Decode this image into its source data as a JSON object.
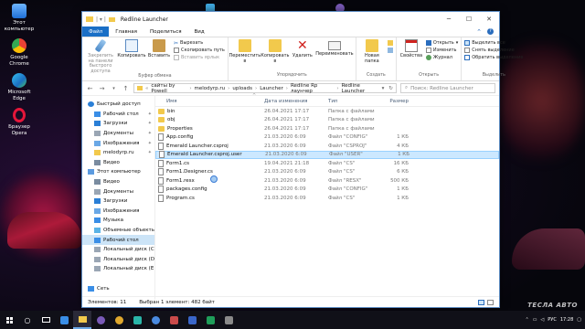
{
  "desktop": {
    "icons": [
      {
        "label": "Этот компьютер",
        "icon": "computer-icon"
      },
      {
        "label": "Google Chrome",
        "icon": "chrome-icon"
      },
      {
        "label": "Microsoft Edge",
        "icon": "edge-icon"
      },
      {
        "label": "Браузер Opera",
        "icon": "opera-icon"
      }
    ],
    "watermark": "ТЕСЛА АВТО"
  },
  "window": {
    "title": "Redline Launcher",
    "tabs": {
      "file": "Файл",
      "home": "Главная",
      "share": "Поделиться",
      "view": "Вид"
    },
    "ribbon": {
      "pin_quick": "Закрепить на панели быстрого доступа",
      "copy": "Копировать",
      "paste": "Вставить",
      "cut": "Вырезать",
      "copy_path": "Скопировать путь",
      "paste_shortcut": "Вставить ярлык",
      "clipboard_group": "Буфер обмена",
      "move_to": "Переместить в",
      "copy_to": "Копировать в",
      "delete": "Удалить",
      "rename": "Переименовать",
      "organize_group": "Упорядочить",
      "new_folder": "Новая папка",
      "new_group": "Создать",
      "properties": "Свойства",
      "open": "Открыть",
      "edit": "Изменить",
      "history": "Журнал",
      "open_group": "Открыть",
      "select_all": "Выделить все",
      "select_none": "Снять выделение",
      "invert_selection": "Обратить выделение",
      "select_group": "Выделить"
    },
    "address": {
      "crumbs": [
        "сайты by Powell",
        "melodyrp.ru",
        "uploads",
        "Launcher",
        "Redline Rp лаунчер",
        "Redline Launcher"
      ],
      "search_placeholder": "Поиск: Redline Launcher"
    },
    "nav": [
      {
        "label": "Быстрый доступ",
        "icon": "star-icon",
        "child": false,
        "pin": false
      },
      {
        "label": "Рабочий стол",
        "icon": "desktop-icon",
        "child": true,
        "pin": true
      },
      {
        "label": "Загрузки",
        "icon": "download-icon",
        "child": true,
        "pin": true
      },
      {
        "label": "Документы",
        "icon": "documents-icon",
        "child": true,
        "pin": true
      },
      {
        "label": "Изображения",
        "icon": "pictures-icon",
        "child": true,
        "pin": true
      },
      {
        "label": "melodyrp.ru",
        "icon": "folder-icon",
        "child": true,
        "pin": true
      },
      {
        "label": "Видео",
        "icon": "video-icon",
        "child": true,
        "pin": false
      },
      {
        "label": "Этот компьютер",
        "icon": "computer-icon",
        "child": false,
        "pin": false
      },
      {
        "label": "Видео",
        "icon": "video-icon",
        "child": true,
        "pin": false
      },
      {
        "label": "Документы",
        "icon": "documents-icon",
        "child": true,
        "pin": false
      },
      {
        "label": "Загрузки",
        "icon": "download-icon",
        "child": true,
        "pin": false
      },
      {
        "label": "Изображения",
        "icon": "pictures-icon",
        "child": true,
        "pin": false
      },
      {
        "label": "Музыка",
        "icon": "music-icon",
        "child": true,
        "pin": false
      },
      {
        "label": "Объемные объекты",
        "icon": "3d-objects-icon",
        "child": true,
        "pin": false
      },
      {
        "label": "Рабочий стол",
        "icon": "desktop-icon",
        "child": true,
        "pin": false,
        "selected": true
      },
      {
        "label": "Локальный диск (C",
        "icon": "drive-icon",
        "child": true,
        "pin": false
      },
      {
        "label": "Локальный диск (D",
        "icon": "drive-icon",
        "child": true,
        "pin": false
      },
      {
        "label": "Локальный диск (E",
        "icon": "drive-icon",
        "child": true,
        "pin": false
      },
      {
        "label": "",
        "icon": "",
        "child": false,
        "pin": false
      },
      {
        "label": "Сеть",
        "icon": "network-icon",
        "child": false,
        "pin": false
      }
    ],
    "columns": {
      "name": "Имя",
      "date": "Дата изменения",
      "type": "Тип",
      "size": "Размер"
    },
    "files": [
      {
        "name": "bin",
        "date": "26.04.2021 17:17",
        "type": "Папка с файлами",
        "size": "",
        "kind": "folder"
      },
      {
        "name": "obj",
        "date": "26.04.2021 17:17",
        "type": "Папка с файлами",
        "size": "",
        "kind": "folder"
      },
      {
        "name": "Properties",
        "date": "26.04.2021 17:17",
        "type": "Папка с файлами",
        "size": "",
        "kind": "folder"
      },
      {
        "name": "App.config",
        "date": "21.03.2020 6:09",
        "type": "Файл \"CONFIG\"",
        "size": "1 КБ",
        "kind": "file"
      },
      {
        "name": "Emerald Launcher.csproj",
        "date": "21.03.2020 6:09",
        "type": "Файл \"CSPROJ\"",
        "size": "4 КБ",
        "kind": "file"
      },
      {
        "name": "Emerald Launcher.csproj.user",
        "date": "21.03.2020 6:09",
        "type": "Файл \"USER\"",
        "size": "1 КБ",
        "kind": "file",
        "selected": true
      },
      {
        "name": "Form1.cs",
        "date": "19.04.2021 21:18",
        "type": "Файл \"CS\"",
        "size": "16 КБ",
        "kind": "file"
      },
      {
        "name": "Form1.Designer.cs",
        "date": "21.03.2020 6:09",
        "type": "Файл \"CS\"",
        "size": "6 КБ",
        "kind": "file"
      },
      {
        "name": "Form1.resx",
        "date": "21.03.2020 6:09",
        "type": "Файл \"RESX\"",
        "size": "500 КБ",
        "kind": "file"
      },
      {
        "name": "packages.config",
        "date": "21.03.2020 6:09",
        "type": "Файл \"CONFIG\"",
        "size": "1 КБ",
        "kind": "file"
      },
      {
        "name": "Program.cs",
        "date": "21.03.2020 6:09",
        "type": "Файл \"CS\"",
        "size": "1 КБ",
        "kind": "file"
      }
    ],
    "status": {
      "count": "Элементов: 11",
      "selection": "Выбран 1 элемент: 482 байт"
    }
  },
  "taskbar": {
    "time": "17:28",
    "lang": "РУС"
  }
}
